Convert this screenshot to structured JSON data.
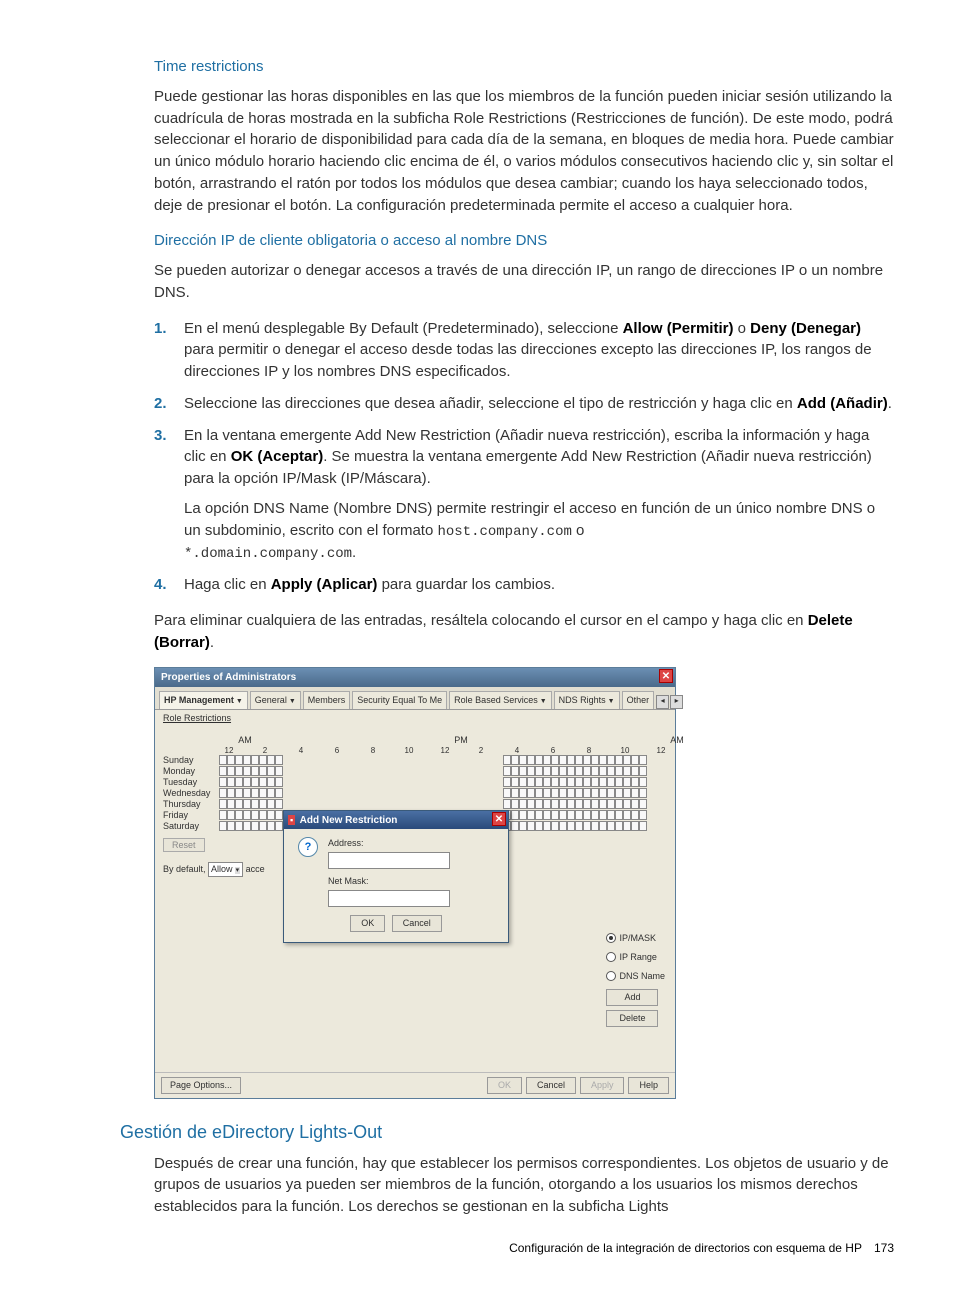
{
  "section1": {
    "title": "Time restrictions",
    "para": "Puede gestionar las horas disponibles en las que los miembros de la función pueden iniciar sesión utilizando la cuadrícula de horas mostrada en la subficha Role Restrictions (Restricciones de función). De este modo, podrá seleccionar el horario de disponibilidad para cada día de la semana, en bloques de media hora. Puede cambiar un único módulo horario haciendo clic encima de él, o varios módulos consecutivos haciendo clic y, sin soltar el botón, arrastrando el ratón por todos los módulos que desea cambiar; cuando los haya seleccionado todos, deje de presionar el botón. La configuración predeterminada permite el acceso a cualquier hora."
  },
  "section2": {
    "title": "Dirección IP de cliente obligatoria o acceso al nombre DNS",
    "para": "Se pueden autorizar o denegar accesos a través de una dirección IP, un rango de direcciones IP o un nombre DNS.",
    "steps": {
      "s1a": "En el menú desplegable By Default (Predeterminado), seleccione ",
      "s1b": "Allow (Permitir)",
      "s1c": " o ",
      "s1d": "Deny (Denegar)",
      "s1e": " para permitir o denegar el acceso desde todas las direcciones excepto las direcciones IP, los rangos de direcciones IP y los nombres DNS especificados.",
      "s2a": "Seleccione las direcciones que desea añadir, seleccione el tipo de restricción y haga clic en ",
      "s2b": "Add (Añadir)",
      "s2c": ".",
      "s3a": "En la ventana emergente Add New Restriction (Añadir nueva restricción), escriba la información y haga clic en ",
      "s3b": "OK (Aceptar)",
      "s3c": ". Se muestra la ventana emergente Add New Restriction (Añadir nueva restricción) para la opción IP/Mask (IP/Máscara).",
      "s3d": "La opción DNS Name (Nombre DNS) permite restringir el acceso en función de un único nombre DNS o un subdominio, escrito con el formato ",
      "s3e": "host.company.com",
      "s3f": " o ",
      "s3g": "*.domain.company.com",
      "s3h": ".",
      "s4a": "Haga clic en ",
      "s4b": "Apply (Aplicar)",
      "s4c": " para guardar los cambios."
    },
    "after_a": "Para eliminar cualquiera de las entradas, resáltela colocando el cursor en el campo y haga clic en ",
    "after_b": "Delete (Borrar)",
    "after_c": "."
  },
  "screenshot": {
    "title": "Properties of Administrators",
    "tabs": {
      "hp": "HP Management",
      "general": "General",
      "members": "Members",
      "seq": "Security Equal To Me",
      "rbs": "Role Based Services",
      "nds": "NDS Rights",
      "other": "Other"
    },
    "role_sub": "Role Restrictions",
    "am": "AM",
    "pm": "PM",
    "am2": "AM",
    "hours": [
      "12",
      "2",
      "4",
      "6",
      "8",
      "10",
      "12",
      "2",
      "4",
      "6",
      "8",
      "10",
      "12"
    ],
    "days": [
      "Sunday",
      "Monday",
      "Tuesday",
      "Wednesday",
      "Thursday",
      "Friday",
      "Saturday"
    ],
    "reset": "Reset",
    "default_a": "By default,",
    "default_sel": "Allow",
    "default_b": "acce",
    "radios": {
      "ipmask": "IP/MASK",
      "iprange": "IP Range",
      "dns": "DNS Name"
    },
    "side_btn_add": "Add",
    "side_btn_del": "Delete",
    "popup": {
      "title": "Add New Restriction",
      "addr": "Address:",
      "mask": "Net Mask:",
      "ok": "OK",
      "cancel": "Cancel"
    },
    "bottom": {
      "po": "Page Options...",
      "ok": "OK",
      "cancel": "Cancel",
      "apply": "Apply",
      "help": "Help"
    }
  },
  "section3": {
    "title": "Gestión de eDirectory Lights-Out",
    "para": "Después de crear una función, hay que establecer los permisos correspondientes. Los objetos de usuario y de grupos de usuarios ya pueden ser miembros de la función, otorgando a los usuarios los mismos derechos establecidos para la función. Los derechos se gestionan en la subficha Lights"
  },
  "footer": {
    "text": "Configuración de la integración de directorios con esquema de HP",
    "page": "173"
  },
  "nums": {
    "n1": "1.",
    "n2": "2.",
    "n3": "3.",
    "n4": "4."
  }
}
